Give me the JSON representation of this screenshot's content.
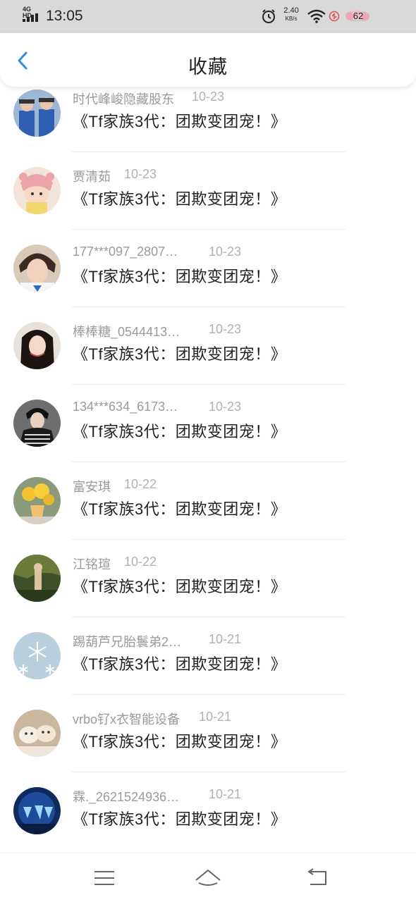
{
  "status_bar": {
    "network": "4G HD",
    "time": "13:05",
    "speed_value": "2.40",
    "speed_unit": "KB/s",
    "battery": "62",
    "icons": [
      "signal-icon",
      "alarm-icon",
      "wifi-icon",
      "sync-icon",
      "battery-icon"
    ]
  },
  "header": {
    "title": "收藏",
    "back_icon": "chevron-left-icon"
  },
  "colors": {
    "accent": "#2b8fe6",
    "status_bar_bg": "#d9d9d9",
    "title_text": "#222222",
    "meta_text": "#9a9a9a"
  },
  "favorites": [
    {
      "user": "时代峰峻隐藏股东",
      "date": "10-23",
      "title": "《Tf家族3代：团欺变团宠！》"
    },
    {
      "user": "贾清茹",
      "date": "10-23",
      "title": "《Tf家族3代：团欺变团宠！》"
    },
    {
      "user": "177***097_2807…",
      "date": "10-23",
      "title": "《Tf家族3代：团欺变团宠！》"
    },
    {
      "user": "棒棒糖_0544413…",
      "date": "10-23",
      "title": "《Tf家族3代：团欺变团宠！》"
    },
    {
      "user": "134***634_6173…",
      "date": "10-23",
      "title": "《Tf家族3代：团欺变团宠！》"
    },
    {
      "user": "富安琪",
      "date": "10-22",
      "title": "《Tf家族3代：团欺变团宠！》"
    },
    {
      "user": "江铭瑄",
      "date": "10-22",
      "title": "《Tf家族3代：团欺变团宠！》"
    },
    {
      "user": "踢葫芦兄胎鬟弟2…",
      "date": "10-21",
      "title": "《Tf家族3代：团欺变团宠！》"
    },
    {
      "user": "vrbo钌x衣智能设备",
      "date": "10-21",
      "title": "《Tf家族3代：团欺变团宠！》"
    },
    {
      "user": "霖._2621524936…",
      "date": "10-21",
      "title": "《Tf家族3代：团欺变团宠！》"
    }
  ],
  "bottom_nav": {
    "icons": [
      "menu-icon",
      "home-icon",
      "back-arrow-icon"
    ]
  }
}
